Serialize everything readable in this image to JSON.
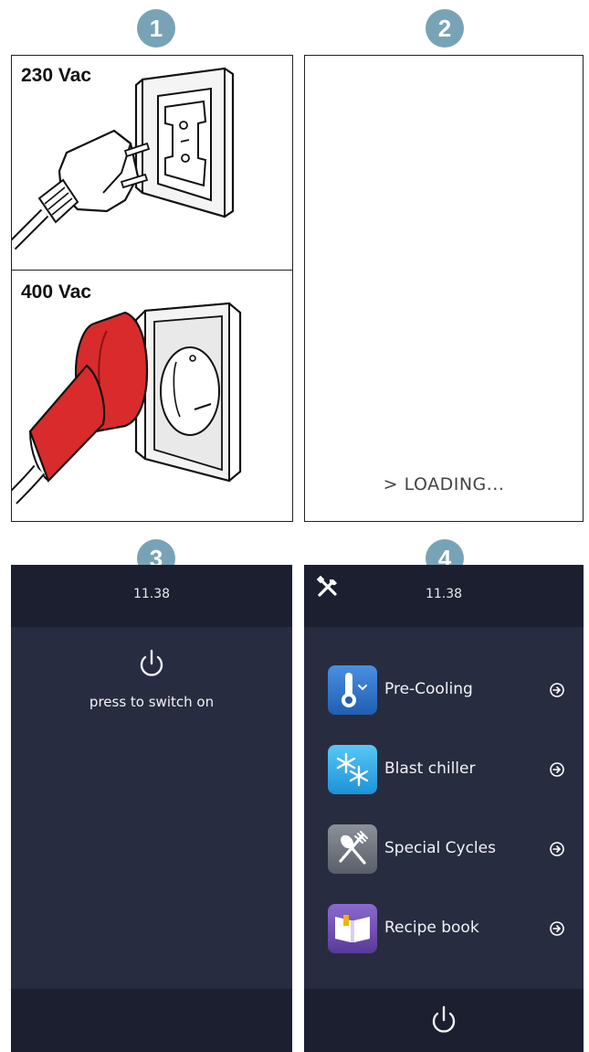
{
  "steps": {
    "step1": "1",
    "step2": "2",
    "step3": "3",
    "step4": "4"
  },
  "panel1": {
    "voltage_230": "230 Vac",
    "voltage_400": "400 Vac"
  },
  "panel2": {
    "loading_text": "> LOADING..."
  },
  "screen3": {
    "time": "11.38",
    "power_prompt": "press to switch on",
    "power_icon": "power-icon"
  },
  "screen4": {
    "time": "11.38",
    "settings_icon": "tools-icon",
    "menu": [
      {
        "label": "Pre-Cooling",
        "icon": "thermometer-down-icon",
        "color": "#2b6fc4"
      },
      {
        "label": "Blast chiller",
        "icon": "snowflake-icon",
        "color": "#33a8e6"
      },
      {
        "label": "Special Cycles",
        "icon": "fork-spoon-icon",
        "color": "#6a6e78"
      },
      {
        "label": "Recipe book",
        "icon": "open-book-icon",
        "color": "#6a4aa8"
      }
    ],
    "power_icon": "power-icon"
  },
  "colors": {
    "badge": "#78a3b6",
    "screen_bg": "#282c40",
    "bar_bg": "#1c1f2f",
    "plug_red": "#d92b2b"
  }
}
